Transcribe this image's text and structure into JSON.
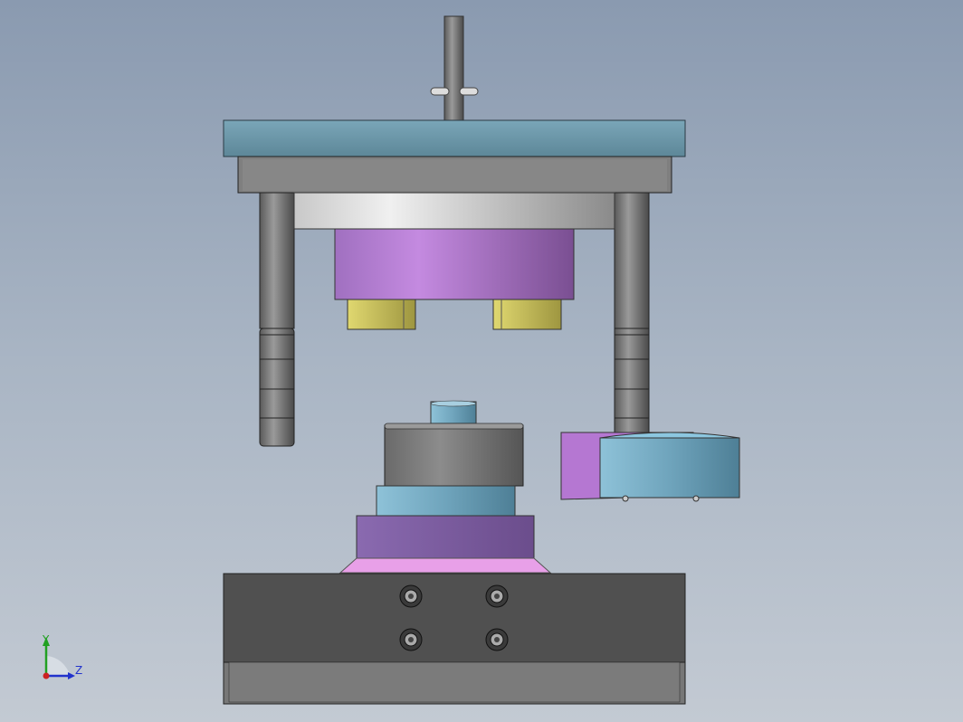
{
  "scene": {
    "type": "CAD 3D model viewport (die / press tool assembly, front view)",
    "axis_triad": {
      "y_label": "Y",
      "z_label": "Z",
      "colors": {
        "y": "#22a022",
        "z": "#2233cc",
        "x": "#cc2222"
      }
    },
    "palette": {
      "background_top": "#8a9ab0",
      "background_bottom": "#c3cad3",
      "top_plate": "#6a95a8",
      "steel_gray": "#7a7a7a",
      "dark_block": "#505050",
      "magenta_part": "#b077cc",
      "yellow_part": "#c9c267",
      "light_blue_part": "#7fb0c8",
      "purple_part": "#7e5fa0",
      "pink_flange": "#e8a0e8"
    }
  }
}
